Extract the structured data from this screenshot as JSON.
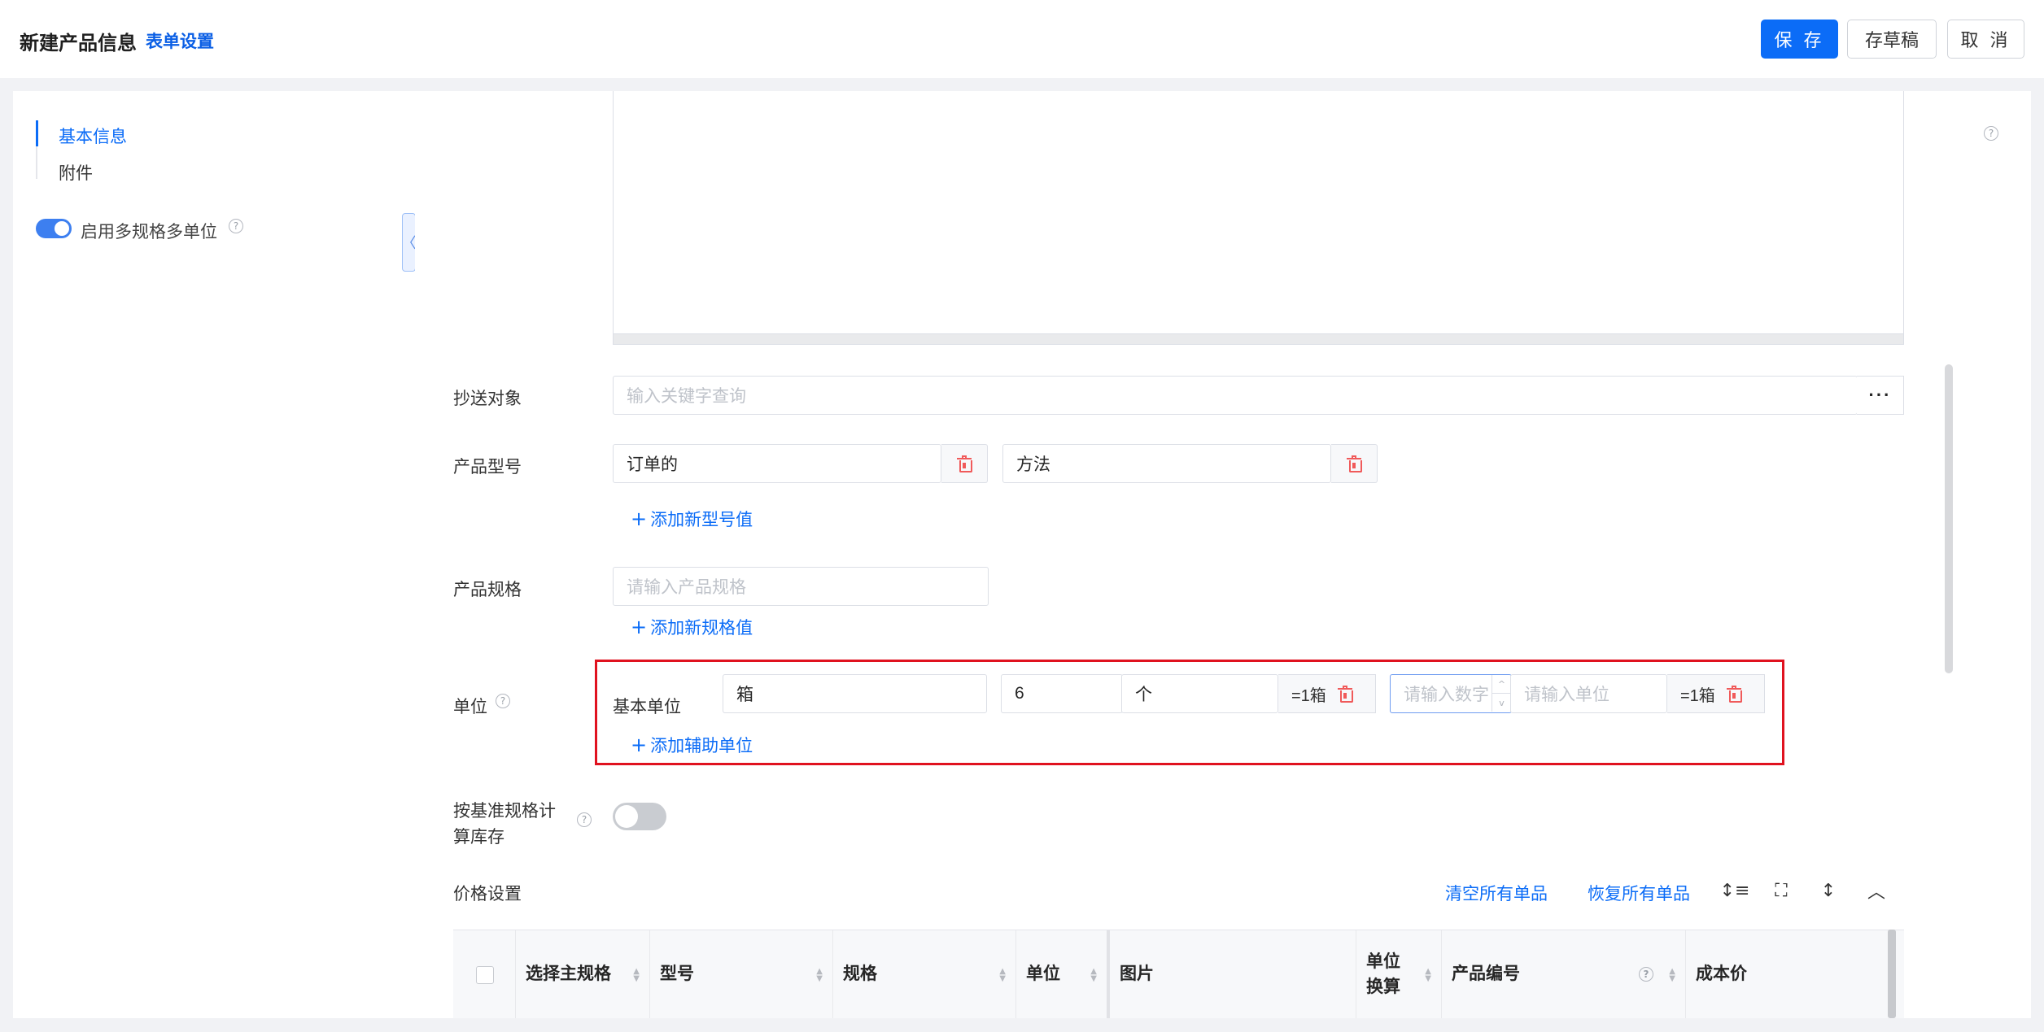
{
  "header": {
    "title": "新建产品信息",
    "form_settings": "表单设置",
    "save": "保 存",
    "draft": "存草稿",
    "cancel": "取 消"
  },
  "sidebar": {
    "items": [
      {
        "label": "基本信息",
        "active": true
      },
      {
        "label": "附件",
        "active": false
      }
    ],
    "multi_spec_toggle_label": "启用多规格多单位",
    "multi_spec_enabled": true,
    "collapse_glyph": "〈"
  },
  "form": {
    "cc": {
      "label": "抄送对象",
      "placeholder": "输入关键字查询",
      "more": "···"
    },
    "model": {
      "label": "产品型号",
      "values": [
        "订单的",
        "方法"
      ],
      "add": "添加新型号值"
    },
    "spec": {
      "label": "产品规格",
      "placeholder": "请输入产品规格",
      "add": "添加新规格值"
    },
    "unit": {
      "label": "单位",
      "base_label": "基本单位",
      "base_value": "箱",
      "aux": [
        {
          "qty": "6",
          "unit": "个",
          "eq": "=1箱"
        },
        {
          "qty_placeholder": "请输入数字",
          "unit_placeholder": "请输入单位",
          "eq": "=1箱"
        }
      ],
      "add": "添加辅助单位"
    },
    "stock_by_base": {
      "label_line1": "按基准规格计",
      "label_line2": "算库存",
      "enabled": false
    },
    "price": {
      "title": "价格设置",
      "clear_all": "清空所有单品",
      "restore_all": "恢复所有单品"
    }
  },
  "table": {
    "columns": [
      {
        "label": "选择主规格"
      },
      {
        "label": "型号"
      },
      {
        "label": "规格"
      },
      {
        "label": "单位"
      },
      {
        "label": "图片"
      },
      {
        "label": "单位\n换算"
      },
      {
        "label": "产品编号"
      },
      {
        "label": "成本价"
      }
    ]
  },
  "icons": {
    "help": "?",
    "plus": "+",
    "density": "↕≡",
    "fullscreen": "⛶",
    "expand": "↕",
    "collapse": "︿",
    "sort_up": "▲",
    "sort_down": "▼",
    "step_up": "^",
    "step_down": "v"
  },
  "colors": {
    "primary": "#0b6cf7",
    "danger": "#f05a5a",
    "highlight": "#e0121f"
  }
}
